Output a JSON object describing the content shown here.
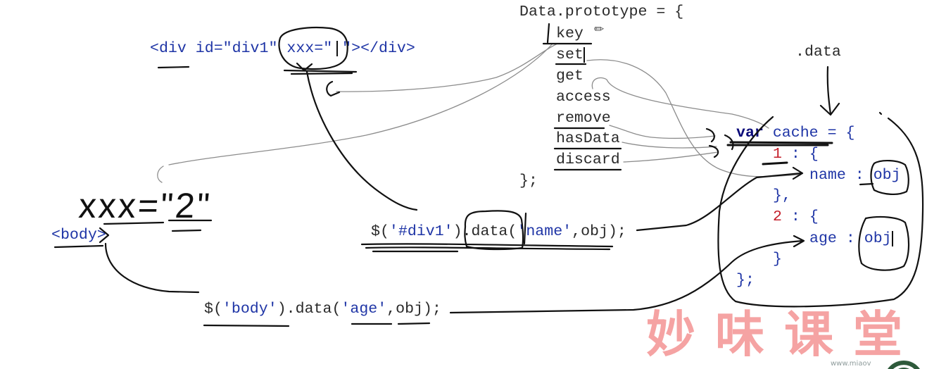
{
  "colors": {
    "background": "#ffffff",
    "code_dark": "#2a2a2a",
    "code_blue": "#1f35a6",
    "keyword": "#0b0b7a",
    "number": "#c41e2a",
    "ink": "#111111",
    "connector": "#8c8c8c",
    "watermark": "#f5a3a3",
    "logo": "#2e5a3b"
  },
  "html_line": {
    "before_cursor": "<div id=\"div1\" xxx=\"",
    "after_cursor": "\"></div>"
  },
  "handwritten_note": "xxx=\"2\"",
  "body_tag": "<body>",
  "data_prototype": {
    "open": "Data.prototype = {",
    "methods": [
      "key",
      "set",
      "get",
      "access",
      "remove",
      "hasData",
      "discard"
    ],
    "close": "};"
  },
  "data_label": ".data",
  "cache": {
    "keyword": "var",
    "declaration": " cache = {",
    "entries": [
      {
        "key": "1",
        "open": " : {",
        "property": "name : obj",
        "close": "},"
      },
      {
        "key": "2",
        "open": " : {",
        "property": "age : obj",
        "close": "}"
      }
    ],
    "close": "};"
  },
  "calls": [
    {
      "tokens": [
        "$(",
        "'#div1'",
        ").data(",
        "'name'",
        ",obj);"
      ]
    },
    {
      "tokens": [
        "$(",
        "'body'",
        ").data(",
        "'age'",
        ",obj);"
      ]
    }
  ],
  "icons": {
    "pencil_cursor": "✏"
  },
  "watermark": {
    "text": "妙味课堂",
    "site": "www.miaov"
  }
}
